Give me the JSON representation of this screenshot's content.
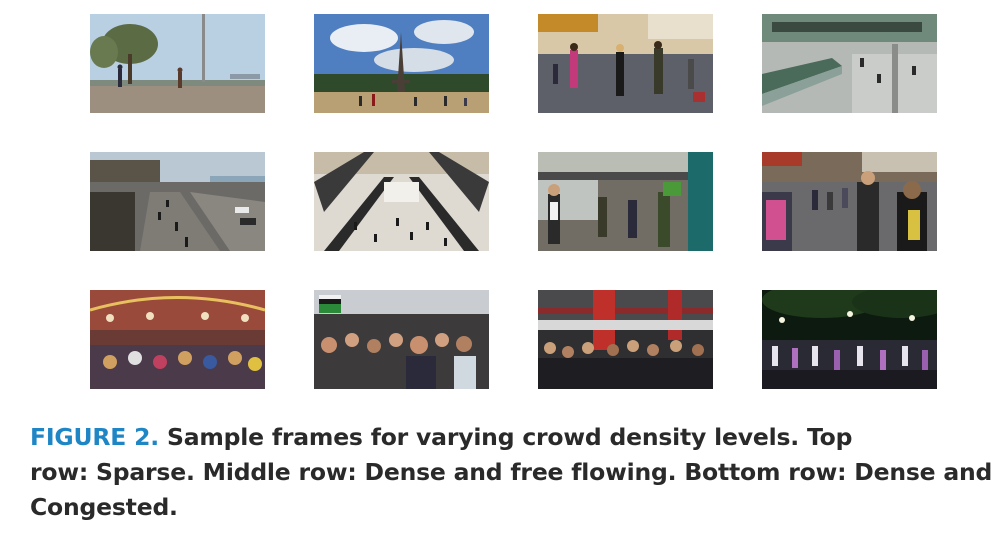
{
  "figure": {
    "label": "FIGURE 2.",
    "caption_line1": "Sample frames for varying crowd density levels. Top",
    "caption_line2": "row: Sparse. Middle row: Dense and free flowing. Bottom row: Dense and",
    "caption_line3": "Congested."
  },
  "frames": [
    {
      "name": "frame-park-plaza-sparse",
      "sky": "#b9cfe2",
      "ground": "#9c8f80",
      "people": 3
    },
    {
      "name": "frame-eiffel-tower-sparse",
      "sky": "#4f7fc0",
      "ground": "#b8a074",
      "people": 6
    },
    {
      "name": "frame-indoor-concourse-sparse",
      "sky": "#d8c8a8",
      "ground": "#5d6068",
      "people": 7
    },
    {
      "name": "frame-atrium-escalator-sparse",
      "sky": "#6f8a7a",
      "ground": "#b4b9b6",
      "people": 3
    },
    {
      "name": "frame-city-street-aerial",
      "sky": "#b9c8d2",
      "ground": "#6c6a66",
      "people": 6
    },
    {
      "name": "frame-mall-escalators",
      "sky": "#c7bca8",
      "ground": "#dedad2",
      "people": 14
    },
    {
      "name": "frame-station-platform",
      "sky": "#b9bdb3",
      "ground": "#716c64",
      "people": 8
    },
    {
      "name": "frame-busy-sidewalk",
      "sky": "#6d6d70",
      "ground": "#6a6a6c",
      "people": 12
    },
    {
      "name": "frame-festival-crowd",
      "sky": "#9a4a3a",
      "ground": "#6a3a34",
      "people": 22
    },
    {
      "name": "frame-protest-crowd",
      "sky": "#c9cdd2",
      "ground": "#3c3a3a",
      "people": 26
    },
    {
      "name": "frame-underground-crowd",
      "sky": "#4a4a4c",
      "ground": "#2f2e30",
      "people": 26
    },
    {
      "name": "frame-night-dance-crowd",
      "sky": "#0c1a10",
      "ground": "#2a2a34",
      "people": 24
    }
  ]
}
